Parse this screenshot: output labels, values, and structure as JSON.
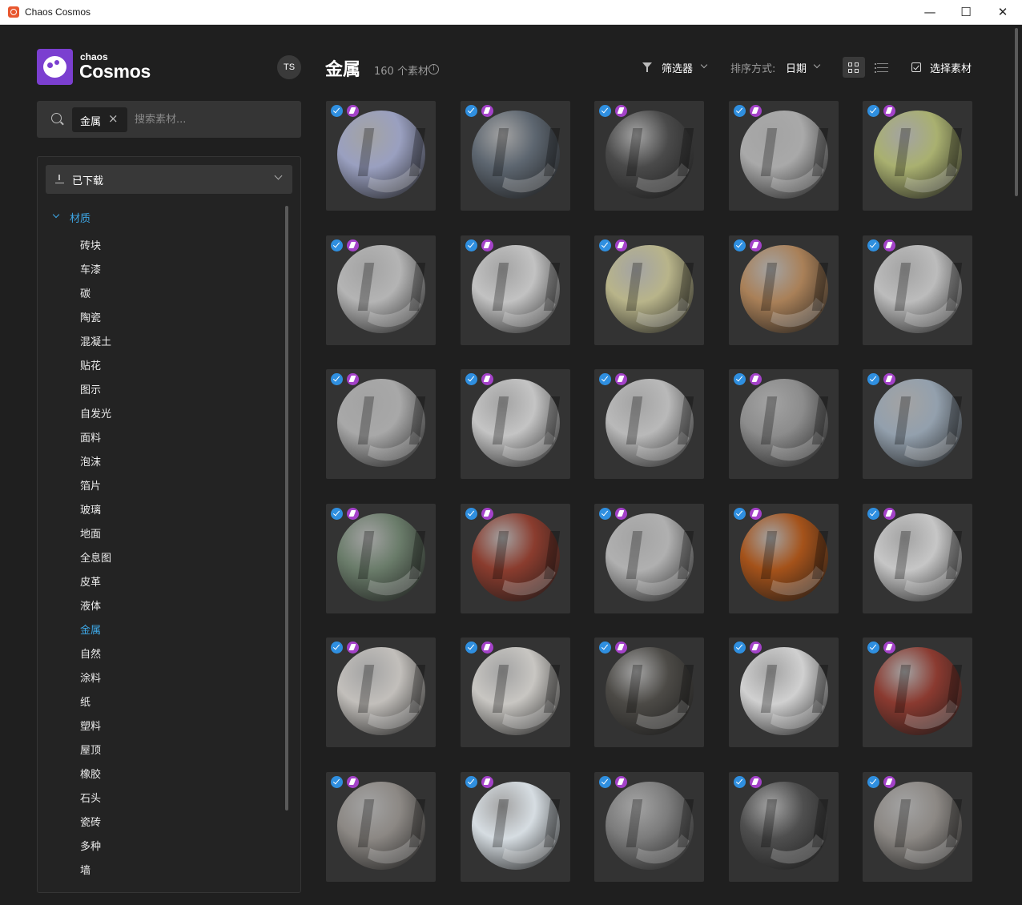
{
  "window": {
    "title": "Chaos Cosmos",
    "minimize_glyph": "—",
    "maximize_glyph": "☐",
    "close_glyph": "✕"
  },
  "sidebar": {
    "logo_small": "chaos",
    "logo_big": "Cosmos",
    "avatar": "TS",
    "search": {
      "chip": "金属",
      "chip_close": "×",
      "placeholder": "搜索素材..."
    },
    "downloaded_label": "已下载",
    "tree_head": "材质",
    "categories": [
      "砖块",
      "车漆",
      "碳",
      "陶瓷",
      "混凝土",
      "贴花",
      "图示",
      "自发光",
      "面料",
      "泡沫",
      "箔片",
      "玻璃",
      "地面",
      "全息图",
      "皮革",
      "液体",
      "金属",
      "自然",
      "涂料",
      "纸",
      "塑料",
      "屋顶",
      "橡胶",
      "石头",
      "瓷砖",
      "多种",
      "墙"
    ],
    "active_category": "金属"
  },
  "header": {
    "title": "金属",
    "count": "160 个素材",
    "info": "i",
    "filter_label": "筛选器",
    "sort_label": "排序方式:",
    "sort_value": "日期",
    "select_label": "选择素材"
  },
  "materials": [
    {
      "color": "#9aa0c0"
    },
    {
      "color": "#5d6670"
    },
    {
      "color": "#4a4a4a"
    },
    {
      "color": "#a9a9a9"
    },
    {
      "color": "#a9b070"
    },
    {
      "color": "#b4b4b4"
    },
    {
      "color": "#c2c2c2"
    },
    {
      "color": "#b8b48a"
    },
    {
      "color": "#a98058"
    },
    {
      "color": "#bcbcbc"
    },
    {
      "color": "#a8a8a8"
    },
    {
      "color": "#c4c4c4"
    },
    {
      "color": "#b9b9b9"
    },
    {
      "color": "#8c8c8c"
    },
    {
      "color": "#93a0ad"
    },
    {
      "color": "#6a7c6a"
    },
    {
      "color": "#8a3c2e"
    },
    {
      "color": "#b0b0b0"
    },
    {
      "color": "#a4521a"
    },
    {
      "color": "#c6c6c6"
    },
    {
      "color": "#c2bfbb"
    },
    {
      "color": "#c8c6c2"
    },
    {
      "color": "#4c4a46"
    },
    {
      "color": "#d0d0d0"
    },
    {
      "color": "#8a3a30"
    },
    {
      "color": "#8c8884"
    },
    {
      "color": "#d6dde2"
    },
    {
      "color": "#7c7c7c"
    },
    {
      "color": "#4f4f4f"
    },
    {
      "color": "#8c8884"
    }
  ]
}
